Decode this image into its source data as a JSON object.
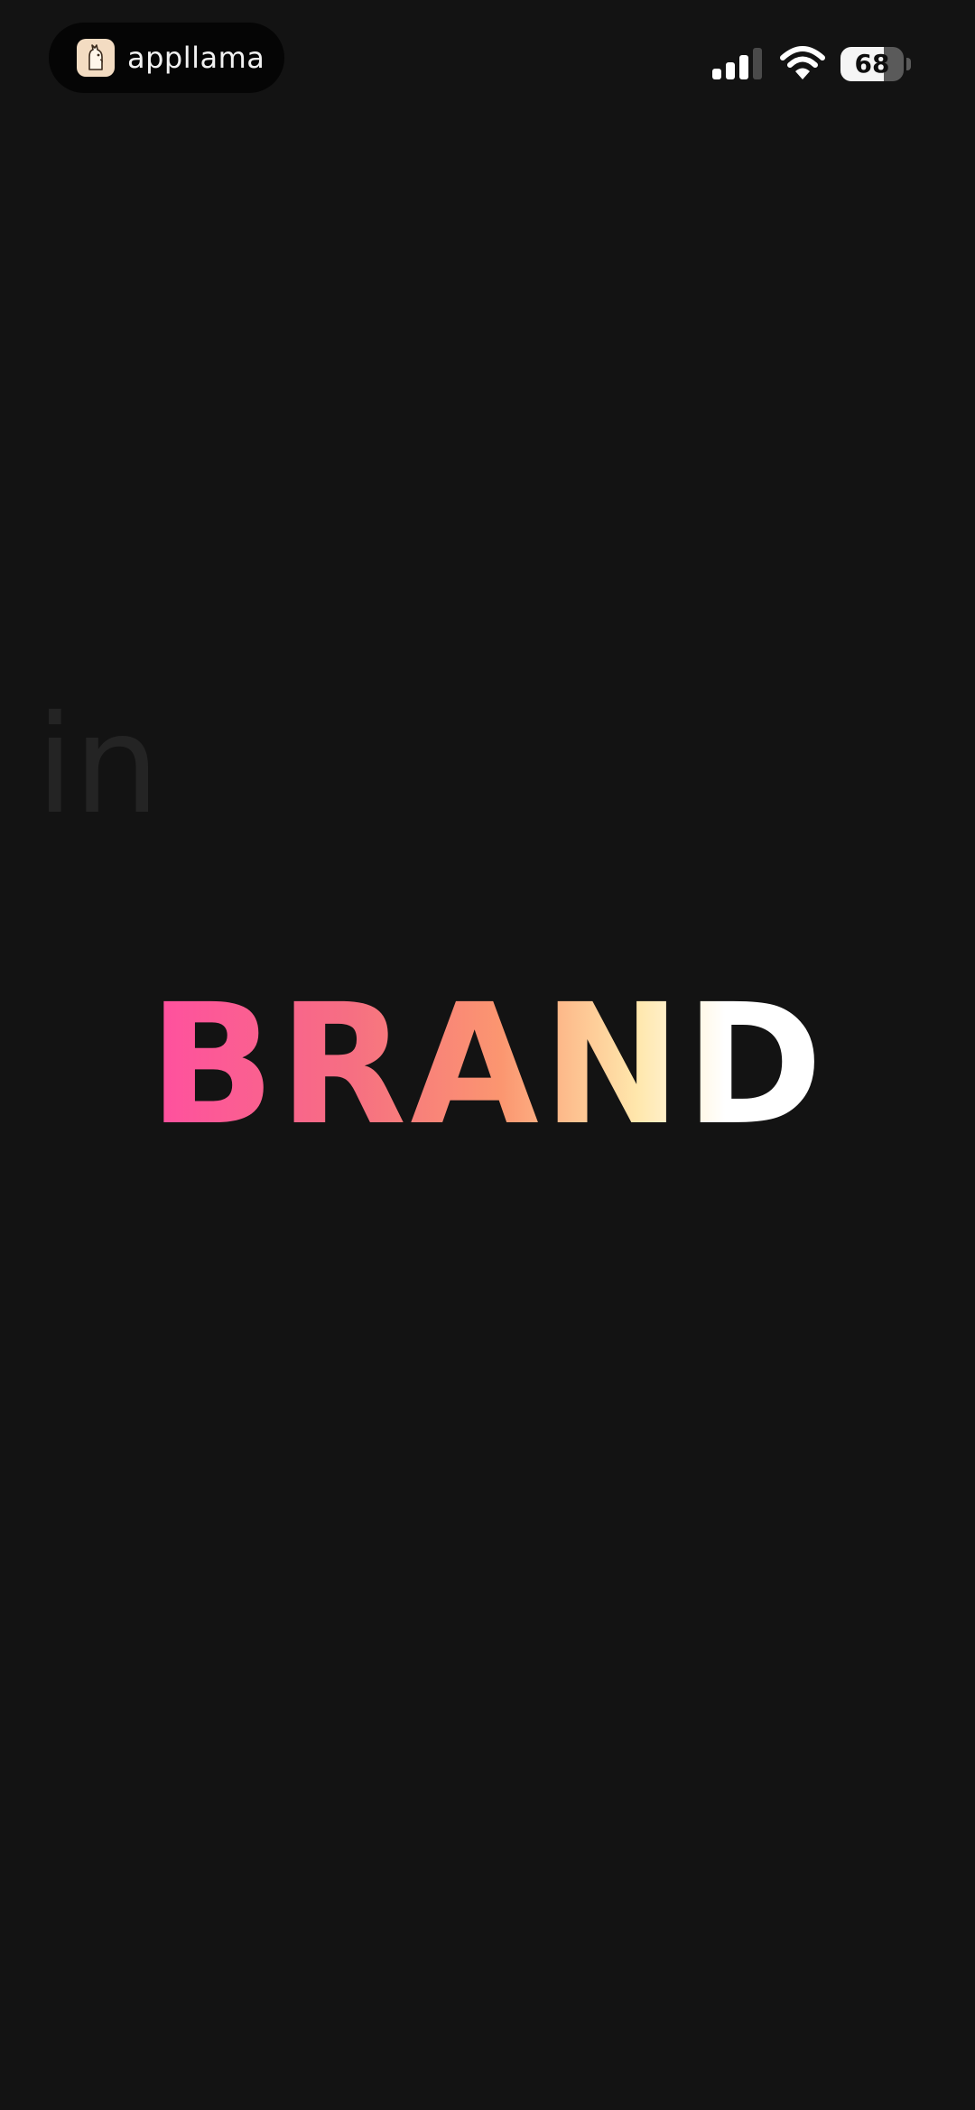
{
  "status_bar": {
    "app_name": "appllama",
    "app_icon": "llama-icon",
    "signal_icon": "cellular-signal-icon",
    "wifi_icon": "wifi-icon",
    "battery_icon": "battery-icon",
    "battery_level": "68",
    "battery_fraction": 0.68
  },
  "content": {
    "faded_word": "in",
    "hero_word": "BRAND"
  },
  "colors": {
    "background": "#131313",
    "pill_background": "#050505",
    "gradient_start": "#ff4fa0",
    "gradient_mid": "#fb9670",
    "gradient_end": "#ffffff"
  }
}
